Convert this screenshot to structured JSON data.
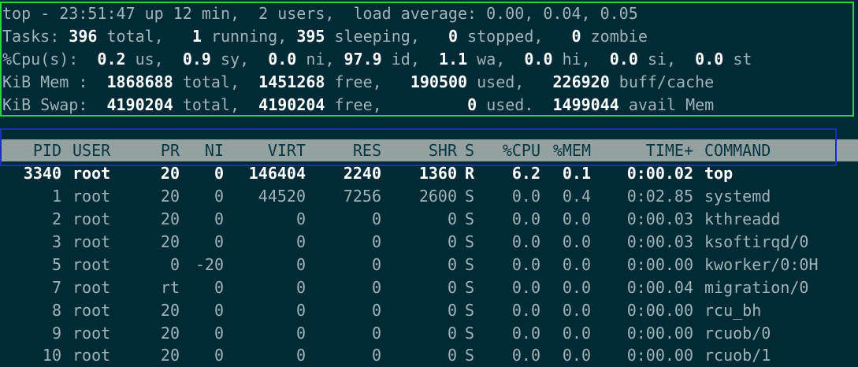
{
  "summary": {
    "line1": "top - 23:51:47 up 12 min,  2 users,  load average: 0.00, 0.04, 0.05",
    "tasks": {
      "label": "Tasks:",
      "total": "396",
      "total_label": "total,",
      "running": "1",
      "running_label": "running,",
      "sleeping": "395",
      "sleeping_label": "sleeping,",
      "stopped": "0",
      "stopped_label": "stopped,",
      "zombie": "0",
      "zombie_label": "zombie"
    },
    "cpu": {
      "label": "%Cpu(s):",
      "us": "0.2",
      "us_label": "us,",
      "sy": "0.9",
      "sy_label": "sy,",
      "ni": "0.0",
      "ni_label": "ni,",
      "id": "97.9",
      "id_label": "id,",
      "wa": "1.1",
      "wa_label": "wa,",
      "hi": "0.0",
      "hi_label": "hi,",
      "si": "0.0",
      "si_label": "si,",
      "st": "0.0",
      "st_label": "st"
    },
    "mem": {
      "label": "KiB Mem :",
      "total": "1868688",
      "total_label": "total,",
      "free": "1451268",
      "free_label": "free,",
      "used": "190500",
      "used_label": "used,",
      "buff": "226920",
      "buff_label": "buff/cache"
    },
    "swap": {
      "label": "KiB Swap:",
      "total": "4190204",
      "total_label": "total,",
      "free": "4190204",
      "free_label": "free,",
      "used": "0",
      "used_label": "used.",
      "avail": "1499044",
      "avail_label": "avail Mem"
    }
  },
  "columns": [
    "PID",
    "USER",
    "PR",
    "NI",
    "VIRT",
    "RES",
    "SHR",
    "S",
    "%CPU",
    "%MEM",
    "TIME+",
    "COMMAND"
  ],
  "processes": [
    {
      "pid": "3340",
      "user": "root",
      "pr": "20",
      "ni": "0",
      "virt": "146404",
      "res": "2240",
      "shr": "1360",
      "s": "R",
      "cpu": "6.2",
      "mem": "0.1",
      "time": "0:00.02",
      "cmd": "top",
      "highlight": true
    },
    {
      "pid": "1",
      "user": "root",
      "pr": "20",
      "ni": "0",
      "virt": "44520",
      "res": "7256",
      "shr": "2600",
      "s": "S",
      "cpu": "0.0",
      "mem": "0.4",
      "time": "0:02.85",
      "cmd": "systemd"
    },
    {
      "pid": "2",
      "user": "root",
      "pr": "20",
      "ni": "0",
      "virt": "0",
      "res": "0",
      "shr": "0",
      "s": "S",
      "cpu": "0.0",
      "mem": "0.0",
      "time": "0:00.03",
      "cmd": "kthreadd"
    },
    {
      "pid": "3",
      "user": "root",
      "pr": "20",
      "ni": "0",
      "virt": "0",
      "res": "0",
      "shr": "0",
      "s": "S",
      "cpu": "0.0",
      "mem": "0.0",
      "time": "0:00.03",
      "cmd": "ksoftirqd/0"
    },
    {
      "pid": "5",
      "user": "root",
      "pr": "0",
      "ni": "-20",
      "virt": "0",
      "res": "0",
      "shr": "0",
      "s": "S",
      "cpu": "0.0",
      "mem": "0.0",
      "time": "0:00.00",
      "cmd": "kworker/0:0H"
    },
    {
      "pid": "7",
      "user": "root",
      "pr": "rt",
      "ni": "0",
      "virt": "0",
      "res": "0",
      "shr": "0",
      "s": "S",
      "cpu": "0.0",
      "mem": "0.0",
      "time": "0:00.04",
      "cmd": "migration/0"
    },
    {
      "pid": "8",
      "user": "root",
      "pr": "20",
      "ni": "0",
      "virt": "0",
      "res": "0",
      "shr": "0",
      "s": "S",
      "cpu": "0.0",
      "mem": "0.0",
      "time": "0:00.00",
      "cmd": "rcu_bh"
    },
    {
      "pid": "9",
      "user": "root",
      "pr": "20",
      "ni": "0",
      "virt": "0",
      "res": "0",
      "shr": "0",
      "s": "S",
      "cpu": "0.0",
      "mem": "0.0",
      "time": "0:00.00",
      "cmd": "rcuob/0"
    },
    {
      "pid": "10",
      "user": "root",
      "pr": "20",
      "ni": "0",
      "virt": "0",
      "res": "0",
      "shr": "0",
      "s": "S",
      "cpu": "0.0",
      "mem": "0.0",
      "time": "0:00.00",
      "cmd": "rcuob/1"
    }
  ],
  "colors": {
    "background": "#002b36",
    "text": "#9fb3b8",
    "bold_text": "#ffffff",
    "header_bar": "#93a1a1",
    "summary_outline": "#2ed33a",
    "header_outline": "#1b2dc8"
  }
}
